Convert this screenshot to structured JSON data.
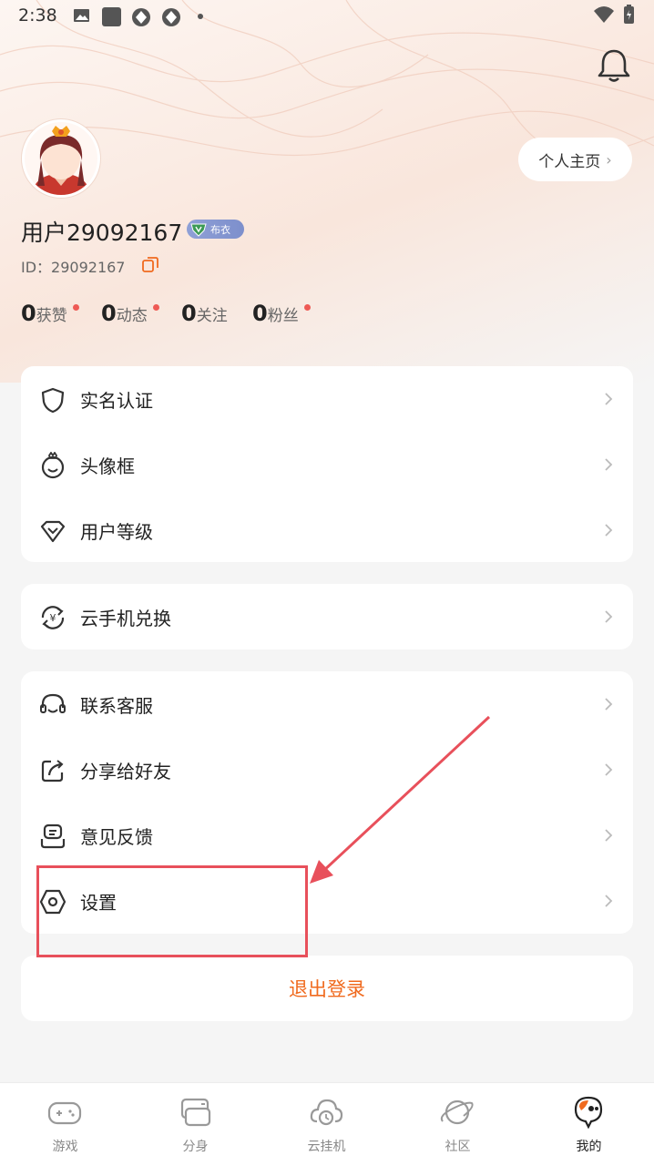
{
  "status_bar": {
    "time": "2:38"
  },
  "profile": {
    "homepage_label": "个人主页",
    "homepage_chevron": "›",
    "username": "用户29092167",
    "level_badge": "布衣",
    "user_id": "ID：29092167"
  },
  "stats": [
    {
      "count": "0",
      "label": "获赞",
      "dot": true
    },
    {
      "count": "0",
      "label": "动态",
      "dot": true
    },
    {
      "count": "0",
      "label": "关注",
      "dot": false
    },
    {
      "count": "0",
      "label": "粉丝",
      "dot": true
    }
  ],
  "menu_group_1": [
    {
      "label": "实名认证",
      "icon": "shield-icon"
    },
    {
      "label": "头像框",
      "icon": "avatar-frame-icon"
    },
    {
      "label": "用户等级",
      "icon": "diamond-icon"
    }
  ],
  "menu_group_2": [
    {
      "label": "云手机兑换",
      "icon": "exchange-icon"
    }
  ],
  "menu_group_3": [
    {
      "label": "联系客服",
      "icon": "headset-icon"
    },
    {
      "label": "分享给好友",
      "icon": "share-icon"
    },
    {
      "label": "意见反馈",
      "icon": "feedback-icon"
    },
    {
      "label": "设置",
      "icon": "settings-hexagon-icon"
    }
  ],
  "chevron": "›",
  "logout_label": "退出登录",
  "tabbar": [
    {
      "label": "游戏",
      "icon": "gamepad-icon",
      "active": false
    },
    {
      "label": "分身",
      "icon": "clone-icon",
      "active": false
    },
    {
      "label": "云挂机",
      "icon": "cloud-clock-icon",
      "active": false
    },
    {
      "label": "社区",
      "icon": "planet-icon",
      "active": false
    },
    {
      "label": "我的",
      "icon": "mascot-icon",
      "active": true
    }
  ],
  "colors": {
    "accent": "#f06a1e",
    "annotation": "#e8505b",
    "badge": "#8fa0d6",
    "notification_dot": "#ee5a55"
  }
}
